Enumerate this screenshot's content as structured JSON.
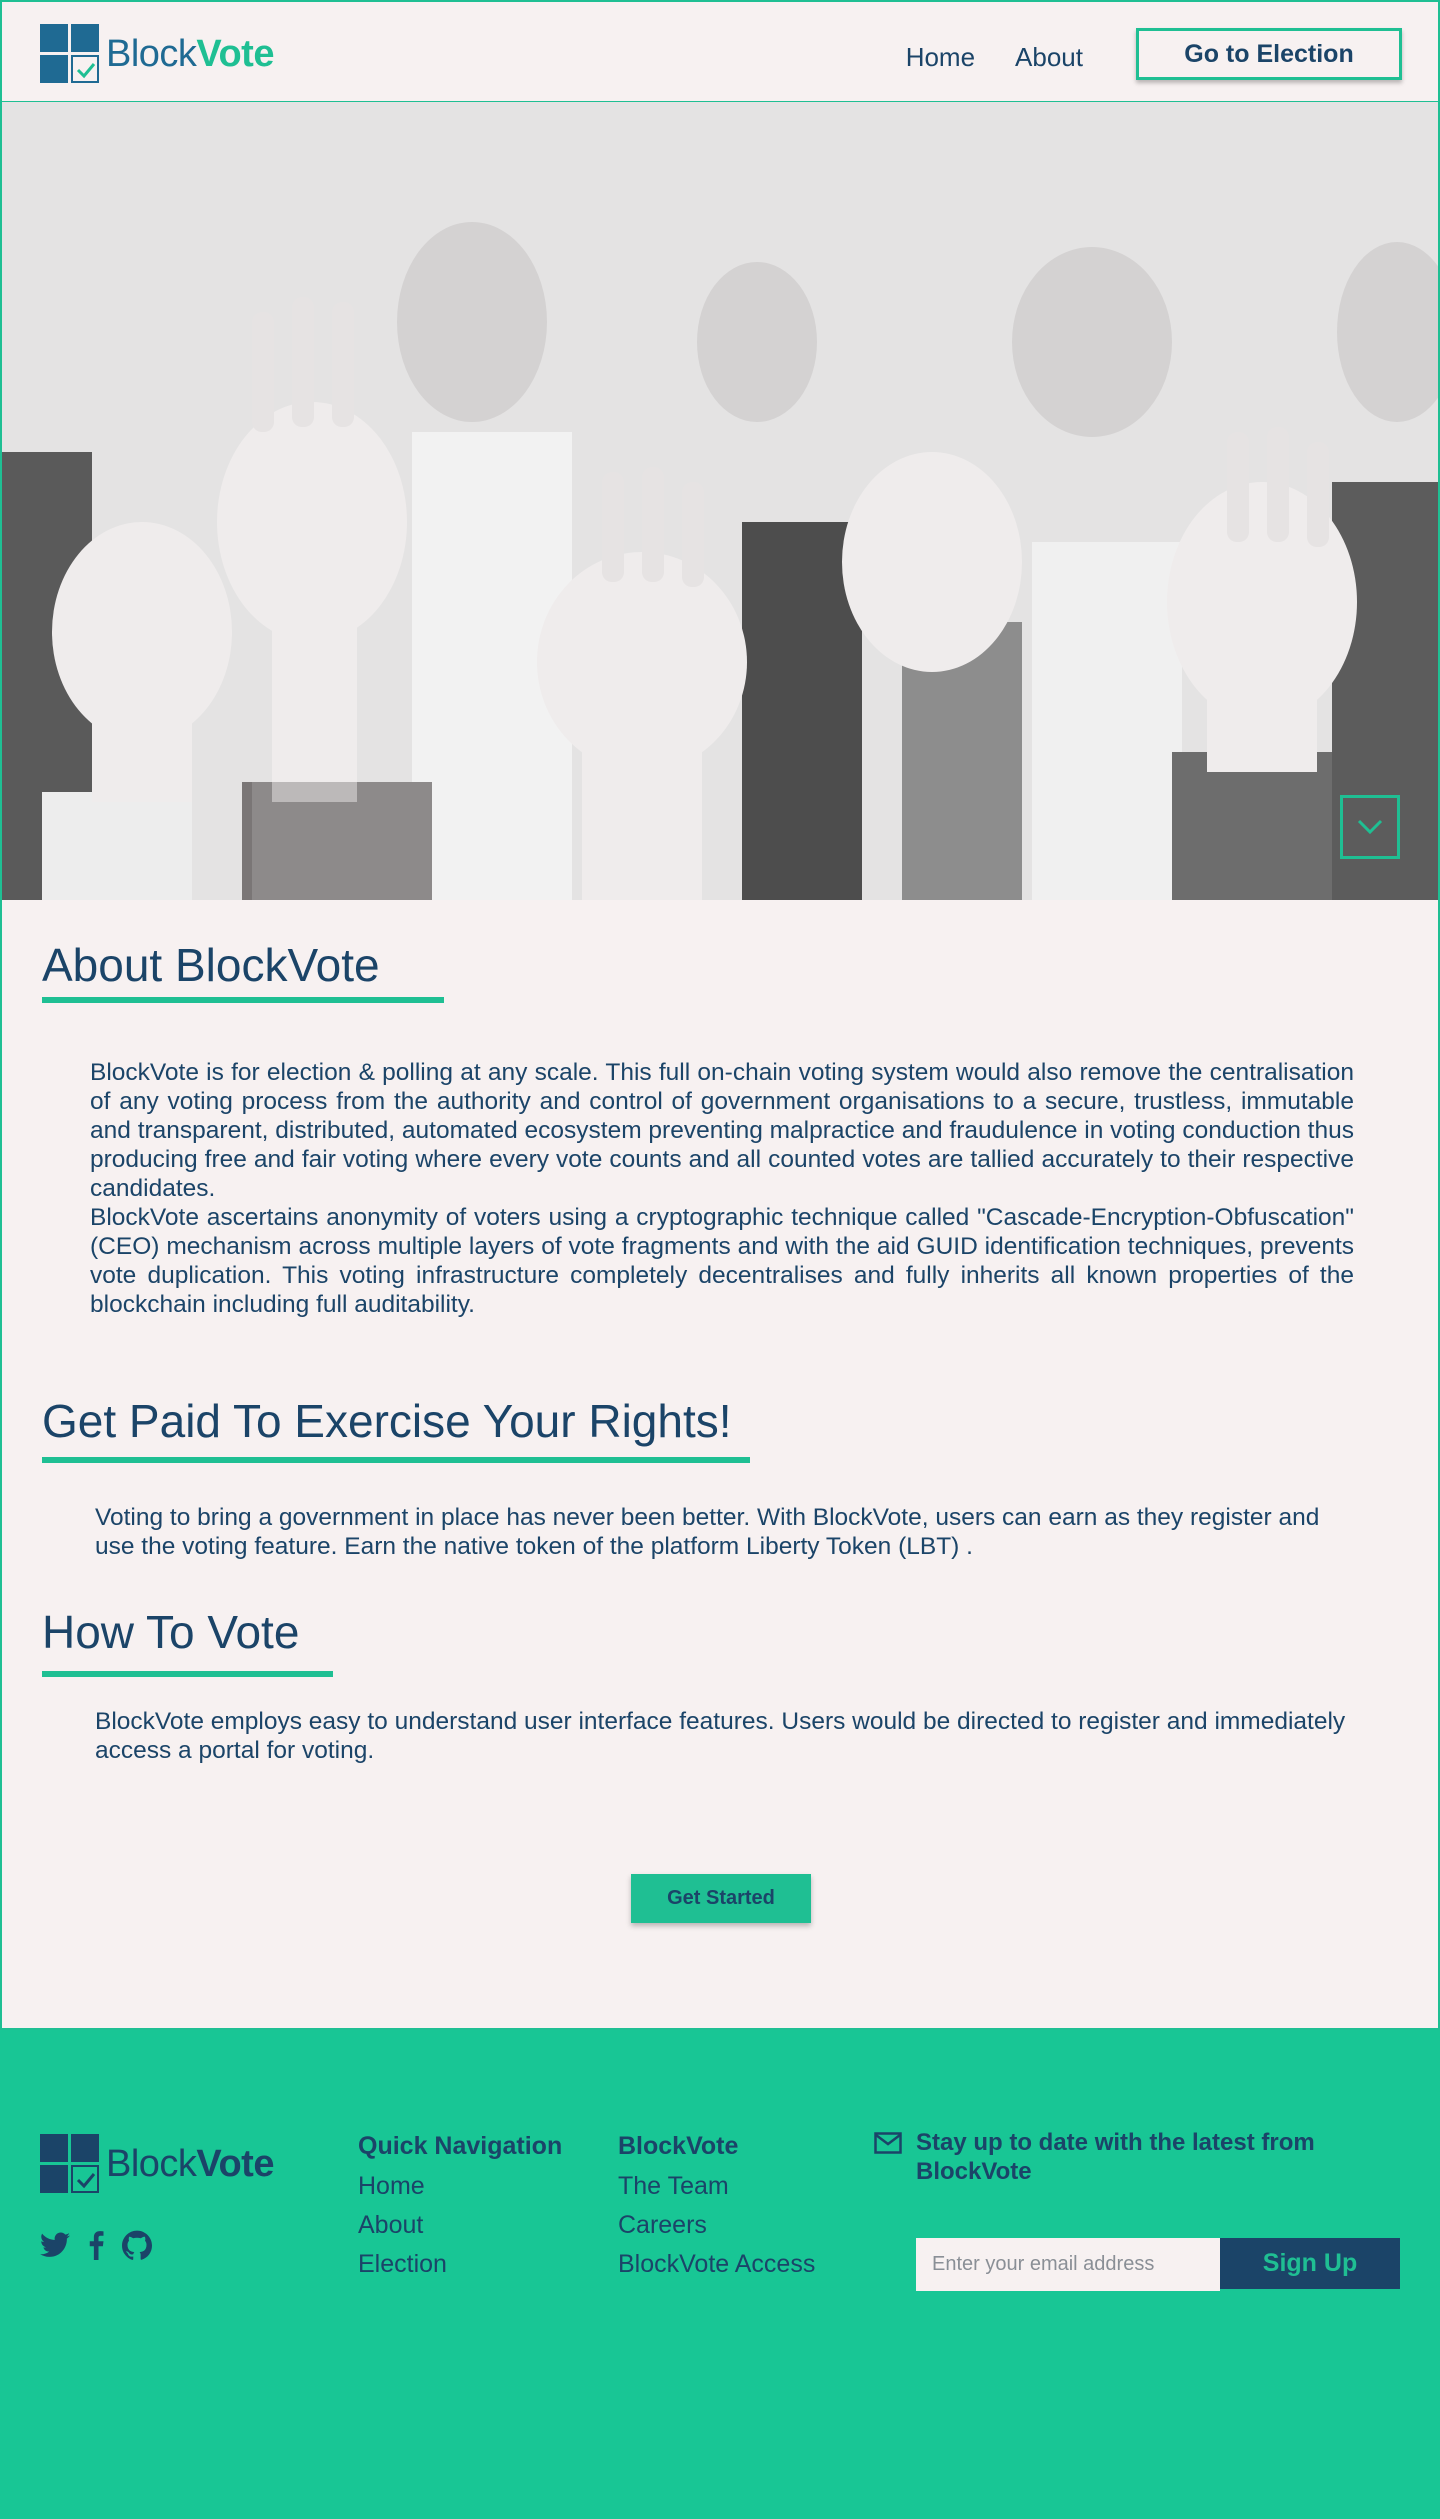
{
  "header": {
    "logo": {
      "light": "Block",
      "bold": "Vote"
    },
    "nav": [
      {
        "label": "Home"
      },
      {
        "label": "About"
      }
    ],
    "cta_label": "Go to Election"
  },
  "hero": {
    "scroll_icon": "chevron-down-icon"
  },
  "about": {
    "title": "About BlockVote",
    "paragraphs": [
      "BlockVote is for election & polling at any scale. This full on-chain voting system would also remove the centralisation of any voting process from the authority and control of government organisations to a secure, trustless, immutable and transparent, distributed, automated ecosystem preventing malpractice and fraudulence in voting conduction thus producing free and fair voting where every vote counts and all counted votes are tallied accurately to their respective candidates.",
      "BlockVote ascertains anonymity of voters using a cryptographic technique called \"Cascade-Encryption-Obfuscation\" (CEO) mechanism across multiple layers of vote fragments and with the aid GUID identification techniques, prevents vote duplication. This voting infrastructure completely decentralises and fully inherits all known properties of the blockchain including full auditability."
    ]
  },
  "paid": {
    "title": "Get Paid To Exercise Your Rights!",
    "text": "Voting to bring a government in place has never been better. With BlockVote, users can earn as they register and use the voting feature. Earn the native token of the platform Liberty Token (LBT) ."
  },
  "how": {
    "title": "How To Vote",
    "text": "BlockVote employs easy to understand user interface features. Users would be directed to register and immediately access a portal for voting."
  },
  "get_started_label": "Get Started",
  "footer": {
    "logo": {
      "light": "Block",
      "bold": "Vote"
    },
    "socials": [
      "twitter-icon",
      "facebook-icon",
      "github-icon"
    ],
    "quick_nav": {
      "head": "Quick Navigation",
      "links": [
        "Home",
        "About",
        "Election"
      ]
    },
    "blockvote": {
      "head": "BlockVote",
      "links": [
        "The Team",
        "Careers",
        "BlockVote Access"
      ]
    },
    "newsletter": {
      "message": "Stay up to date with the latest from BlockVote",
      "placeholder": "Enter your email address",
      "button": "Sign Up"
    }
  },
  "colors": {
    "accent": "#1fbf93",
    "navy": "#1b4468",
    "page_bg": "#f7f1f1",
    "footer_bg": "#18c695"
  }
}
